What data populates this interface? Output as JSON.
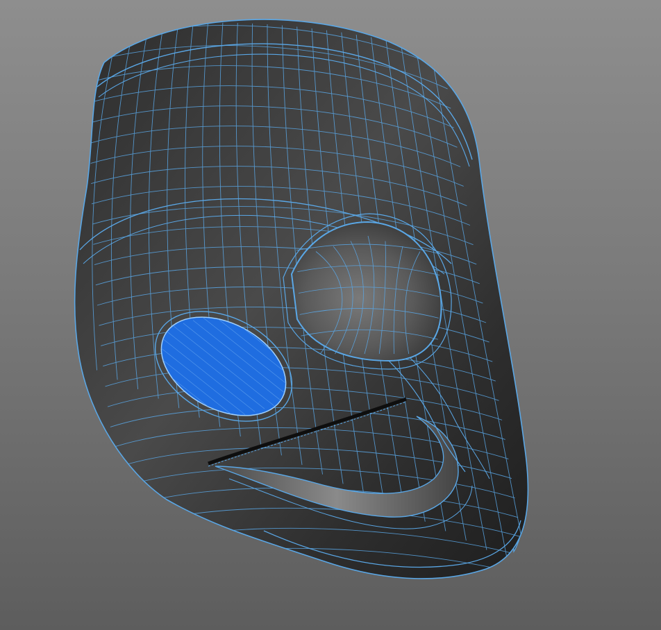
{
  "viewport": {
    "background_top": "#8e8e8e",
    "background_bottom": "#5d5d5d"
  },
  "model": {
    "object": "mask",
    "display_mode": "smooth-shaded-with-wireframe",
    "surface_color": "#3a3a3a",
    "wire_color": "#5aa7e6",
    "selected_face_color": "#1f6de0",
    "selected_region": "left-eye-opening"
  }
}
